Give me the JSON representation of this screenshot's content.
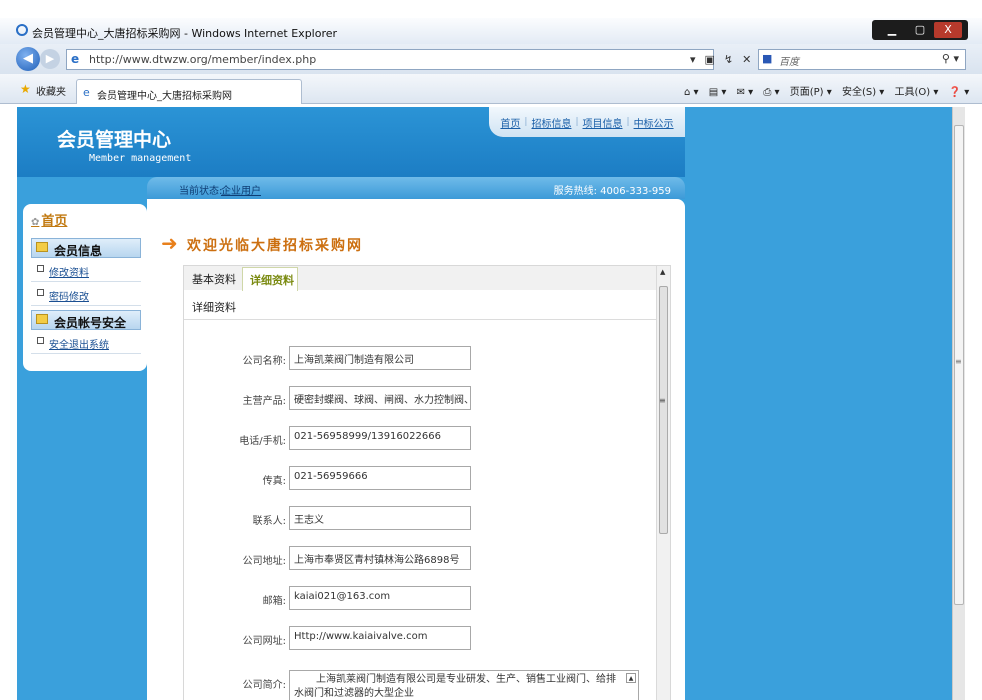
{
  "browser": {
    "window_title": "会员管理中心_大唐招标采购网 - Windows Internet Explorer",
    "url": "http://www.dtwzw.org/member/index.php",
    "search_logo": "百度",
    "favorites_label": "收藏夹",
    "tab_title": "会员管理中心_大唐招标采购网",
    "commands": {
      "page": "页面(P) ▾",
      "safety": "安全(S) ▾",
      "tools": "工具(O) ▾",
      "help": "❓ ▾"
    },
    "min": "▁",
    "max": "▢",
    "close": "X"
  },
  "header": {
    "title": "会员管理中心",
    "subtitle": "Member management",
    "nav": [
      "首页",
      "招标信息",
      "项目信息",
      "中标公示"
    ]
  },
  "status": {
    "label": "当前状态:",
    "value": "企业用户",
    "hotline": "服务热线: 4006-333-959"
  },
  "sidebar": {
    "home": "首页",
    "groups": [
      {
        "label": "会员信息",
        "items": [
          "修改资料",
          "密码修改"
        ]
      },
      {
        "label": "会员帐号安全",
        "items": [
          "安全退出系统"
        ]
      }
    ]
  },
  "main": {
    "welcome": "欢迎光临大唐招标采购网",
    "tabs": [
      "基本资料",
      "详细资料"
    ],
    "section_title": "详细资料",
    "fields": [
      {
        "label": "公司名称:",
        "value": "上海凯莱阀门制造有限公司"
      },
      {
        "label": "主营产品:",
        "value": "硬密封蝶阀、球阀、闸阀、水力控制阀、耐磨阀"
      },
      {
        "label": "电话/手机:",
        "value": "021-56958999/13916022666"
      },
      {
        "label": "传真:",
        "value": "021-56959666"
      },
      {
        "label": "联系人:",
        "value": "王志义"
      },
      {
        "label": "公司地址:",
        "value": "上海市奉贤区青村镇林海公路6898号"
      },
      {
        "label": "邮箱:",
        "value": "kaiai021@163.com"
      },
      {
        "label": "公司网址:",
        "value": "Http://www.kaiaivalve.com"
      },
      {
        "label": "公司简介:",
        "value": "上海凯莱阀门制造有限公司是专业研发、生产、销售工业阀门、给排水阀门和过滤器的大型企业"
      }
    ]
  },
  "icons": {
    "ie": "ie-logo-icon",
    "back": "back-arrow-icon",
    "forward": "forward-arrow-icon",
    "folder": "folder-icon",
    "bullet": "bullet-square-icon",
    "arrow": "orange-arrow-icon"
  },
  "colors": {
    "page_bg": "#3aa0dc",
    "header": "#1c7dc4",
    "welcome": "#cc6f10",
    "detail_tab": "#7a8a10"
  }
}
